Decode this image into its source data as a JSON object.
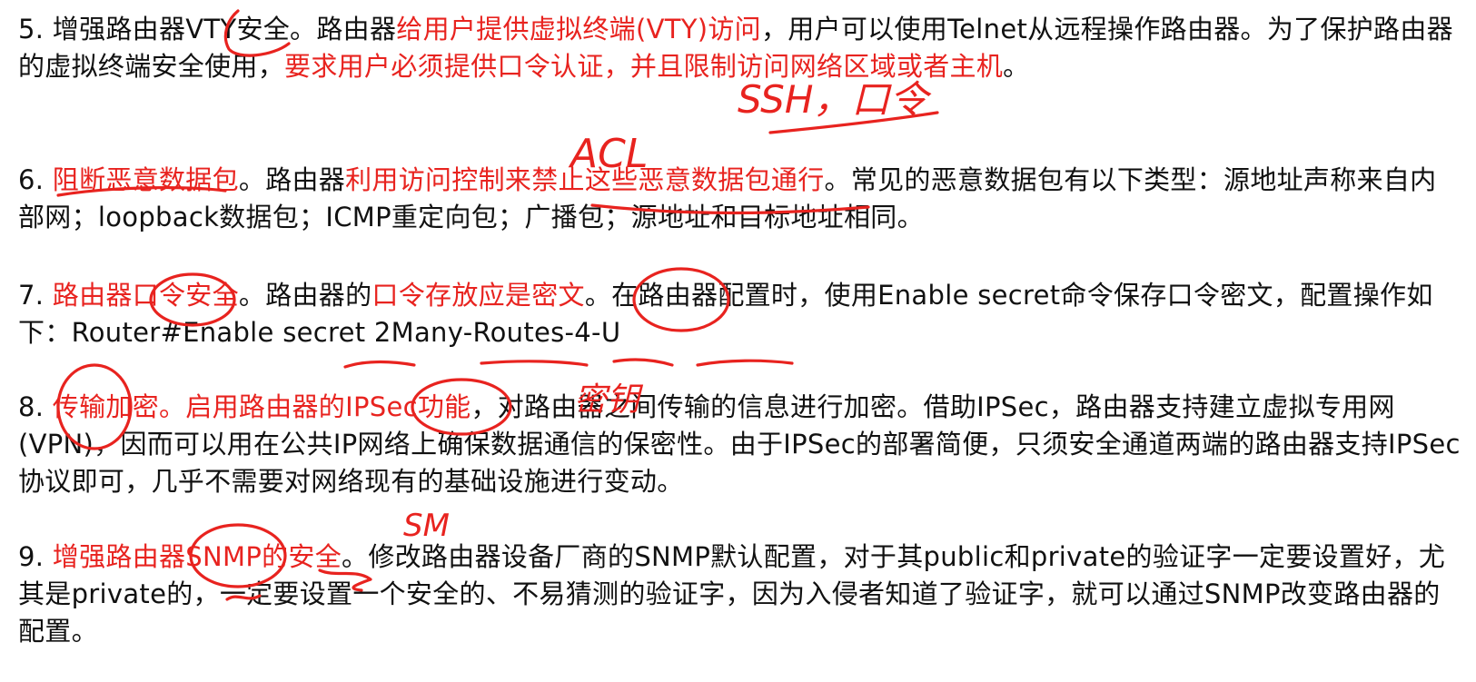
{
  "paragraphs": [
    {
      "id": "p5",
      "segments": [
        {
          "text": "5. 增强路由器VTY安全。路由器",
          "red": false
        },
        {
          "text": "给用户提供虚拟终端(VTY)访问",
          "red": true
        },
        {
          "text": "，用户可以使用Telnet从远程操作路由器。为了保护路由器的虚拟终端安全使用，",
          "red": false
        },
        {
          "text": "要求用户必须提供口令认证，并且限制访问网络区域或者主机",
          "red": true
        },
        {
          "text": "。",
          "red": false
        }
      ]
    },
    {
      "id": "p6",
      "segments": [
        {
          "text": "6. ",
          "red": false
        },
        {
          "text": "阻断恶意数据包",
          "red": true
        },
        {
          "text": "。路由器",
          "red": false
        },
        {
          "text": "利用访问控制来禁止这些恶意数据包通行",
          "red": true
        },
        {
          "text": "。常见的恶意数据包有以下类型：源地址声称来自内部网；loopback数据包；ICMP重定向包；广播包；源地址和目标地址相同。",
          "red": false
        }
      ]
    },
    {
      "id": "p7",
      "segments": [
        {
          "text": "7. ",
          "red": false
        },
        {
          "text": "路由器口令安全",
          "red": true
        },
        {
          "text": "。路由器的",
          "red": false
        },
        {
          "text": "口令存放应是密文",
          "red": true
        },
        {
          "text": "。在路由器配置时，使用Enable secret命令保存口令密文，配置操作如下：Router#Enable secret 2Many-Routes-4-U",
          "red": false
        }
      ]
    },
    {
      "id": "p8",
      "segments": [
        {
          "text": "8. ",
          "red": false
        },
        {
          "text": "传输加密。启用路由器的IPSec功能",
          "red": true
        },
        {
          "text": "，对路由器之间传输的信息进行加密。借助IPSec，路由器支持建立虚拟专用网(VPN)，因而可以用在公共IP网络上确保数据通信的保密性。由于IPSec的部署简便，只须安全通道两端的路由器支持IPSec协议即可，几乎不需要对网络现有的基础设施进行变动。",
          "red": false
        }
      ]
    },
    {
      "id": "p9",
      "segments": [
        {
          "text": "9. ",
          "red": false
        },
        {
          "text": "增强路由器SNMP的安全",
          "red": true
        },
        {
          "text": "。修改路由器设备厂商的SNMP默认配置，对于其public和private的验证字一定要设置好，尤其是private的，一定要设置一个安全的、不易猜测的验证字，因为入侵者知道了验证字，就可以通过SNMP改变路由器的配置。",
          "red": false
        }
      ]
    }
  ],
  "handwritten_notes": {
    "ssh_note": "SSH，口令",
    "acl_note": "ACL",
    "key_note": "密钥",
    "snmp_note": "SM"
  },
  "colors": {
    "text": "#111111",
    "highlight": "#e8231f",
    "background": "#ffffff"
  }
}
